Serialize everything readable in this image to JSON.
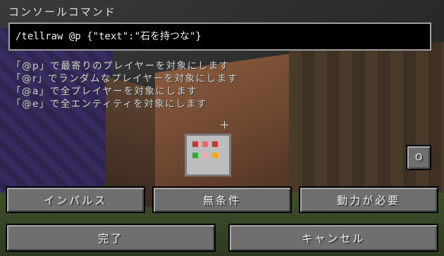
{
  "dialog": {
    "title": "コンソールコマンド",
    "command_value": "/tellraw @p {\"text\":\"石を持つな\"}"
  },
  "help_lines": [
    "「@p」で最寄りのプレイヤーを対象にします",
    "「@r」でランダムなプレイヤーを対象にします",
    "「@a」で全プレイヤーを対象にします",
    "「@e」で全エンティティを対象にします"
  ],
  "output_toggle": {
    "label": "O"
  },
  "mode_buttons": {
    "impulse": "インパルス",
    "unconditional": "無条件",
    "needs_redstone": "動力が必要"
  },
  "footer": {
    "done": "完了",
    "cancel": "キャンセル"
  },
  "colors": {
    "button_face": "#6f6f6f",
    "input_bg": "#000000",
    "text": "#e0e0e0"
  }
}
